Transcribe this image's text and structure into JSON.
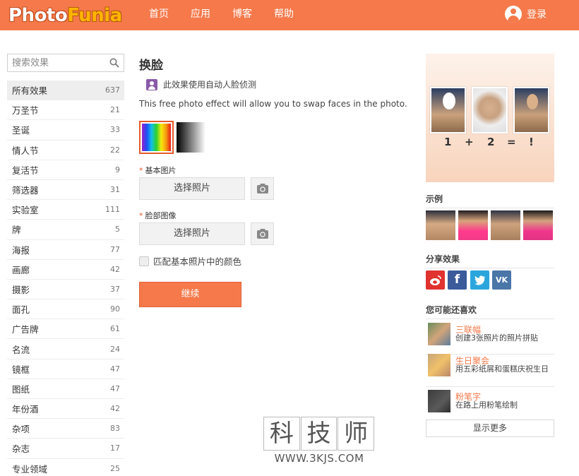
{
  "header": {
    "logo_part1": "Photo",
    "logo_part2": "Funia",
    "nav": [
      "首页",
      "应用",
      "博客",
      "帮助"
    ],
    "login_label": "登录"
  },
  "sidebar": {
    "search_placeholder": "搜索效果",
    "categories": [
      {
        "name": "所有效果",
        "count": "637"
      },
      {
        "name": "万圣节",
        "count": "21"
      },
      {
        "name": "圣诞",
        "count": "33"
      },
      {
        "name": "情人节",
        "count": "22"
      },
      {
        "name": "复活节",
        "count": "9"
      },
      {
        "name": "筛选器",
        "count": "31"
      },
      {
        "name": "实验室",
        "count": "111"
      },
      {
        "name": "牌",
        "count": "5"
      },
      {
        "name": "海报",
        "count": "77"
      },
      {
        "name": "画廊",
        "count": "42"
      },
      {
        "name": "摄影",
        "count": "37"
      },
      {
        "name": "面孔",
        "count": "90"
      },
      {
        "name": "广告牌",
        "count": "61"
      },
      {
        "name": "名流",
        "count": "24"
      },
      {
        "name": "镜框",
        "count": "47"
      },
      {
        "name": "图纸",
        "count": "47"
      },
      {
        "name": "年份酒",
        "count": "42"
      },
      {
        "name": "杂项",
        "count": "83"
      },
      {
        "name": "杂志",
        "count": "17"
      },
      {
        "name": "专业领域",
        "count": "25"
      }
    ]
  },
  "main": {
    "title": "换脸",
    "face_note": "此效果使用自动人脸侦测",
    "description": "This free photo effect will allow you to swap faces in the photo.",
    "field1_label": "基本图片",
    "field2_label": "脸部图像",
    "choose_photo_label": "选择照片",
    "match_color_label": "匹配基本照片中的颜色",
    "continue_label": "继续",
    "accent_color": "#f5794a"
  },
  "right": {
    "equation": [
      "1",
      "+",
      "2",
      "=",
      "!"
    ],
    "examples_title": "示例",
    "share_title": "分享效果",
    "share_buttons": [
      "weibo",
      "f",
      "twitter",
      "vk"
    ],
    "like_title": "您可能还喜欢",
    "likes": [
      {
        "name": "三联幅",
        "desc": "创建3张照片的照片拼贴"
      },
      {
        "name": "生日聚会",
        "desc": "用五彩纸屑和蛋糕庆祝生日"
      },
      {
        "name": "粉笔字",
        "desc": "在路上用粉笔绘制"
      }
    ],
    "more_label": "显示更多"
  },
  "watermark": {
    "chars": [
      "科",
      "技",
      "师"
    ],
    "url": "WWW.3KJS.COM"
  }
}
